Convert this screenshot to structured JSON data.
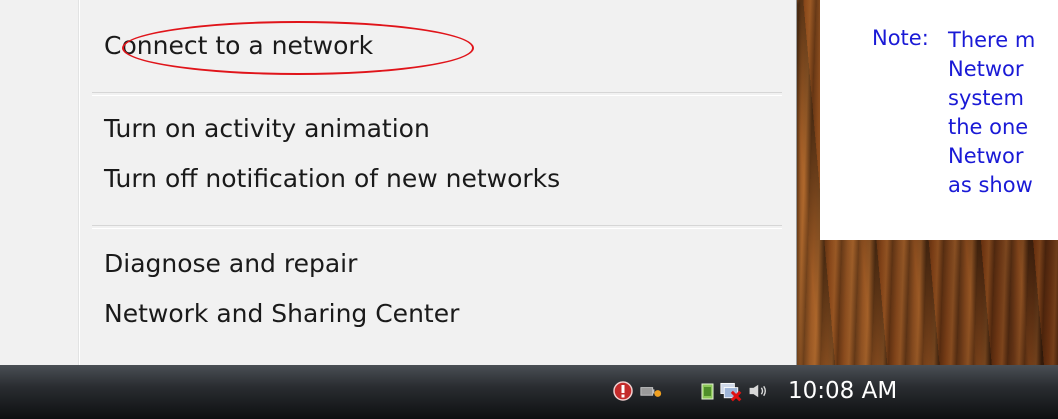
{
  "menu": {
    "items": [
      {
        "label": "Connect to a network"
      },
      {
        "label": "Turn on activity animation"
      },
      {
        "label": "Turn off notification of new networks"
      },
      {
        "label": "Diagnose and repair"
      },
      {
        "label": "Network and Sharing Center"
      }
    ]
  },
  "note": {
    "label": "Note:",
    "lines": [
      "There m",
      "Networ",
      "system",
      "the one",
      "Networ",
      "as show"
    ]
  },
  "taskbar": {
    "clock": "10:08 AM",
    "tray_icons": [
      "security-shield-icon",
      "battery-icon",
      "removable-device-icon",
      "network-disconnected-icon",
      "volume-icon"
    ]
  },
  "colors": {
    "annotation_red": "#e0141a",
    "note_text": "#1a1ad6"
  }
}
